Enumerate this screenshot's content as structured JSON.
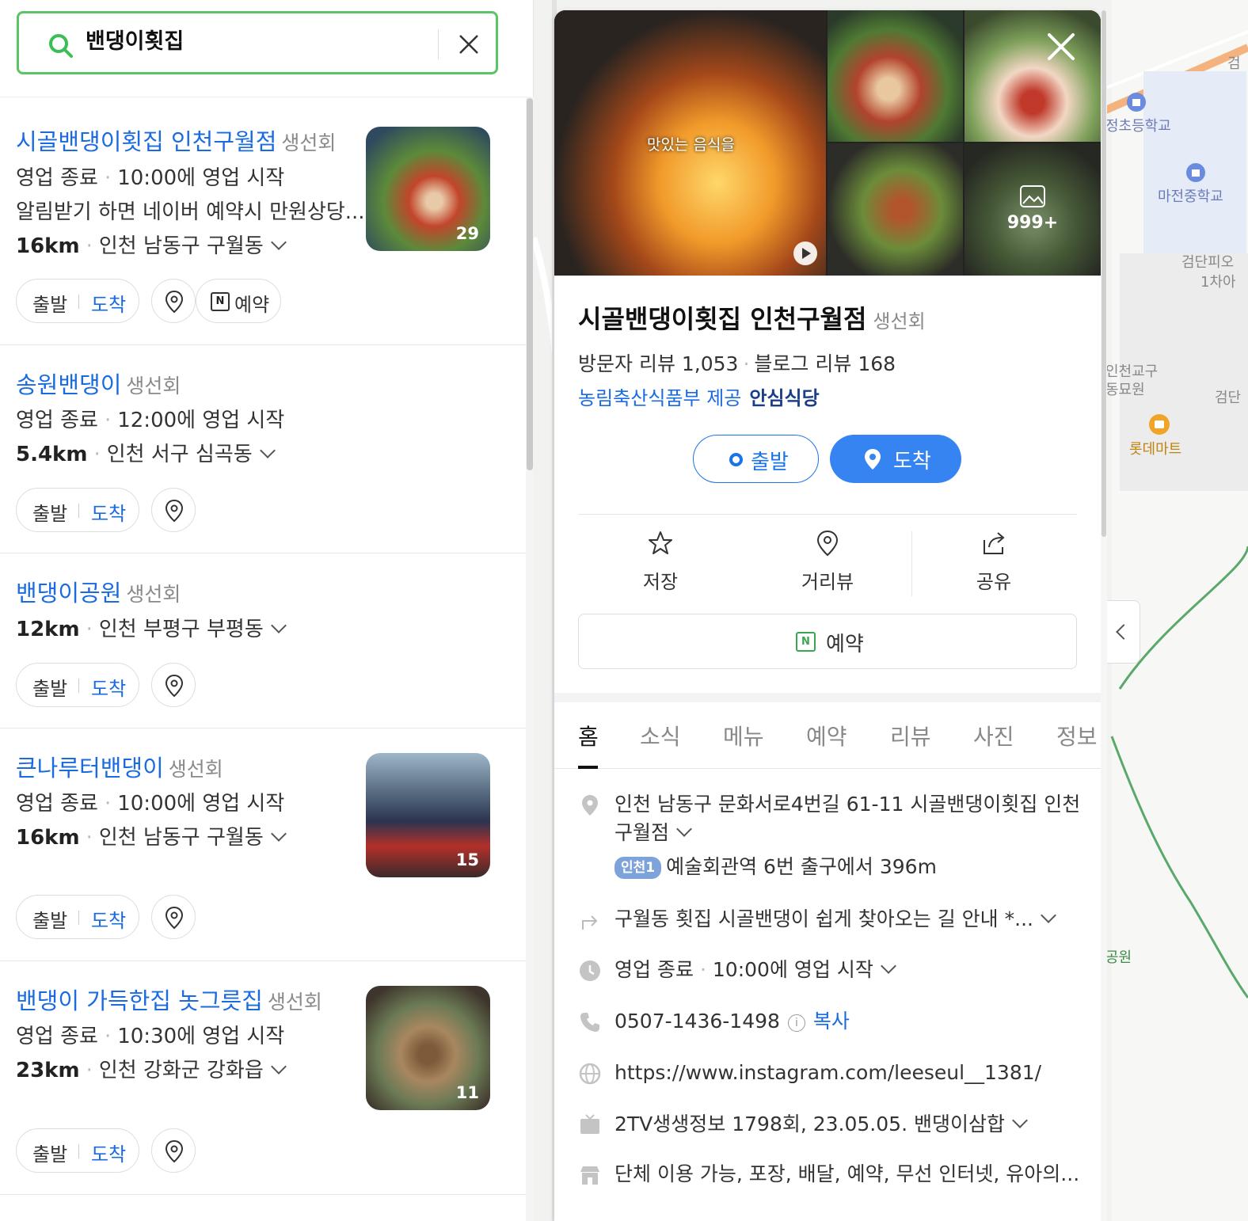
{
  "search": {
    "query": "밴댕이횟집"
  },
  "results": [
    {
      "name": "시골밴댕이횟집 인천구월점",
      "category": "생선회",
      "status": "영업 종료",
      "hours": "10:00에 영업 시작",
      "promo": "알림받기 하면 네이버 예약시 만원상당...",
      "distance": "16km",
      "area": "인천 남동구 구월동",
      "photo_count": "29",
      "btn_depart": "출발",
      "btn_arrive": "도착",
      "btn_book": "예약"
    },
    {
      "name": "송원밴댕이",
      "category": "생선회",
      "status": "영업 종료",
      "hours": "12:00에 영업 시작",
      "distance": "5.4km",
      "area": "인천 서구 심곡동",
      "btn_depart": "출발",
      "btn_arrive": "도착"
    },
    {
      "name": "밴댕이공원",
      "category": "생선회",
      "distance": "12km",
      "area": "인천 부평구 부평동",
      "btn_depart": "출발",
      "btn_arrive": "도착"
    },
    {
      "name": "큰나루터밴댕이",
      "category": "생선회",
      "status": "영업 종료",
      "hours": "10:00에 영업 시작",
      "distance": "16km",
      "area": "인천 남동구 구월동",
      "photo_count": "15",
      "btn_depart": "출발",
      "btn_arrive": "도착"
    },
    {
      "name": "밴댕이 가득한집 놋그릇집",
      "category": "생선회",
      "status": "영업 종료",
      "hours": "10:30에 영업 시작",
      "distance": "23km",
      "area": "인천 강화군 강화읍",
      "photo_count": "11",
      "btn_depart": "출발",
      "btn_arrive": "도착"
    }
  ],
  "map": {
    "labels": [
      "정초등학교",
      "마전중학교",
      "검단피오",
      "1차아",
      "인천교구",
      "동묘원",
      "검단",
      "롯데마트",
      "공원",
      "검"
    ]
  },
  "detail": {
    "video_caption": "맛있는 음식을",
    "photo_more": "999+",
    "name": "시골밴댕이횟집 인천구월점",
    "category": "생선회",
    "visitor_reviews": "방문자 리뷰 1,053",
    "blog_reviews": "블로그 리뷰 168",
    "safe_provider": "농림축산식품부 제공",
    "safe_label": "안심식당",
    "btn_depart": "출발",
    "btn_arrive": "도착",
    "actions": {
      "save": "저장",
      "streetview": "거리뷰",
      "share": "공유"
    },
    "reserve": "예약",
    "tabs": [
      "홈",
      "소식",
      "메뉴",
      "예약",
      "리뷰",
      "사진",
      "정보"
    ],
    "address_line1": "인천 남동구 문화서로4번길 61-11 시골밴댕이횟집 인천",
    "address_line2": "구월점",
    "subway_line": "인천1",
    "subway_desc": "예술회관역 6번 출구에서 396m",
    "directions": "구월동 횟집 시골밴댕이 쉽게 찾아오는 길 안내 *...",
    "status": "영업 종료",
    "hours": "10:00에 영업 시작",
    "phone": "0507-1436-1498",
    "copy": "복사",
    "website": "https://www.instagram.com/leeseul__1381/",
    "tv": "2TV생생정보 1798회, 23.05.05. 밴댕이삼합",
    "amenities": "단체 이용 가능, 포장, 배달, 예약, 무선 인터넷, 유아의..."
  }
}
